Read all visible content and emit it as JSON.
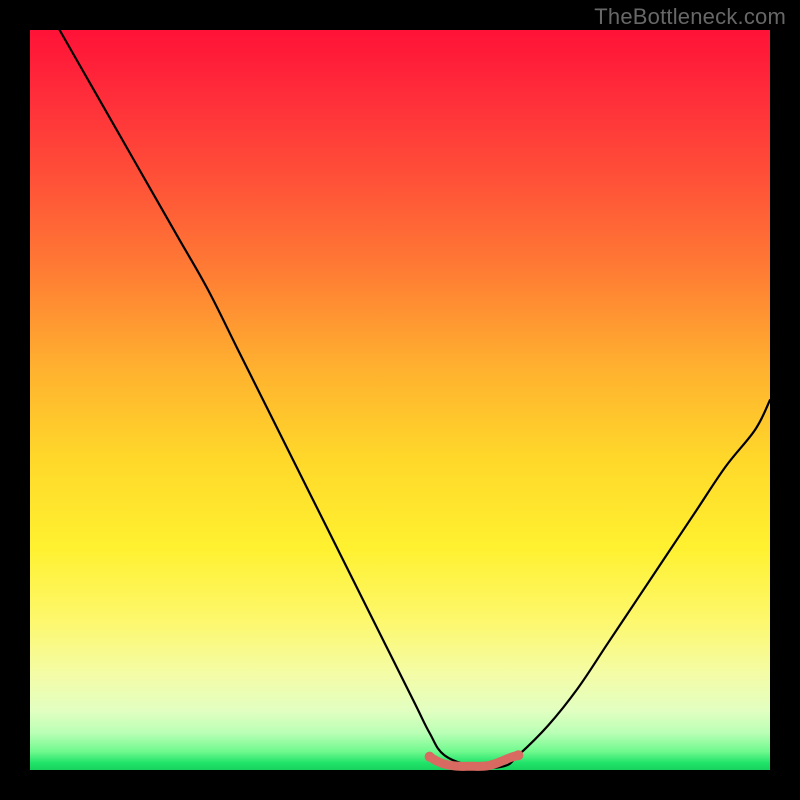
{
  "watermark": {
    "text": "TheBottleneck.com"
  },
  "colors": {
    "curve_stroke": "#000000",
    "trough_stroke": "#d96a62",
    "background_frame": "#000000"
  },
  "chart_data": {
    "type": "line",
    "title": "",
    "xlabel": "",
    "ylabel": "",
    "xlim": [
      0,
      100
    ],
    "ylim": [
      0,
      100
    ],
    "grid": false,
    "series": [
      {
        "name": "bottleneck-curve",
        "x": [
          4,
          8,
          12,
          16,
          20,
          24,
          28,
          32,
          36,
          40,
          44,
          48,
          52,
          54,
          56,
          60,
          64,
          66,
          70,
          74,
          78,
          82,
          86,
          90,
          94,
          98,
          100
        ],
        "y": [
          100,
          93,
          86,
          79,
          72,
          65,
          57,
          49,
          41,
          33,
          25,
          17,
          9,
          5,
          2,
          0.5,
          0.5,
          2,
          6,
          11,
          17,
          23,
          29,
          35,
          41,
          46,
          50
        ]
      },
      {
        "name": "optimal-trough",
        "x": [
          54,
          55,
          56,
          57,
          58,
          59,
          60,
          61,
          62,
          63,
          64,
          65,
          66
        ],
        "y": [
          1.8,
          1.2,
          0.8,
          0.6,
          0.5,
          0.5,
          0.5,
          0.5,
          0.6,
          0.9,
          1.3,
          1.7,
          2.0
        ]
      }
    ]
  }
}
